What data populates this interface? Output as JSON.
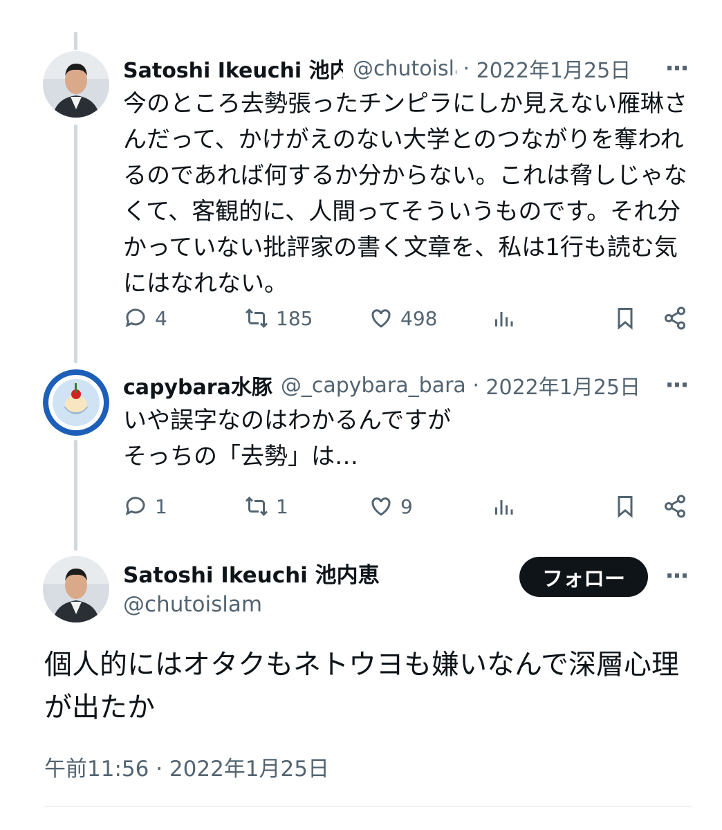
{
  "colors": {
    "text": "#0f1419",
    "secondary": "#536471",
    "thread_line": "#cfd9de",
    "follow_bg": "#0f1419"
  },
  "tweets": [
    {
      "name": "Satoshi Ikeuchi 池内恵",
      "handle": "@chutoislam",
      "date": "2022年1月25日",
      "text": "今のところ去勢張ったチンピラにしか見えない雁琳さんだって、かけがえのない大学とのつながりを奪われるのであれば何するか分からない。これは脅しじゃなくて、客観的に、人間ってそういうものです。それ分かっていない批評家の書く文章を、私は1行も読む気にはなれない。",
      "replies": "4",
      "retweets": "185",
      "likes": "498"
    },
    {
      "name": "capybara水豚",
      "handle": "@_capybara_bara",
      "date": "2022年1月25日",
      "text": "いや誤字なのはわかるんですが\nそっちの「去勢」は…",
      "replies": "1",
      "retweets": "1",
      "likes": "9"
    }
  ],
  "main_tweet": {
    "name": "Satoshi Ikeuchi 池内恵",
    "handle": "@chutoislam",
    "follow_label": "フォロー",
    "text": "個人的にはオタクもネトウヨも嫌いなんで深層心理が出たか",
    "timestamp": "午前11:56 · 2022年1月25日"
  },
  "icons": [
    "reply-icon",
    "retweet-icon",
    "like-icon",
    "views-icon",
    "bookmark-icon",
    "share-icon",
    "more-icon"
  ]
}
